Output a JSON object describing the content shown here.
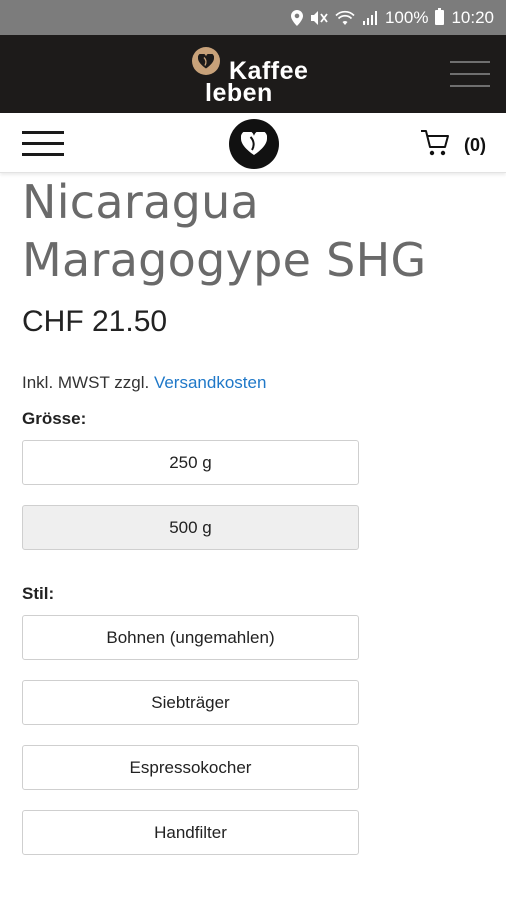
{
  "status_bar": {
    "battery": "100%",
    "time": "10:20"
  },
  "brand": {
    "logo_line1": "Kaffee",
    "logo_line2": "leben"
  },
  "cart": {
    "count": "(0)"
  },
  "product": {
    "title_line1": "Nicaragua",
    "title_line2": "Maragogype SHG",
    "price": "CHF 21.50",
    "tax_prefix": "Inkl. MWST zzgl.",
    "tax_link": "Versandkosten"
  },
  "size": {
    "label": "Grösse:",
    "options": [
      "250 g",
      "500 g"
    ],
    "selected": "500 g"
  },
  "style": {
    "label": "Stil:",
    "options": [
      "Bohnen (ungemahlen)",
      "Siebträger",
      "Espressokocher",
      "Handfilter"
    ]
  }
}
